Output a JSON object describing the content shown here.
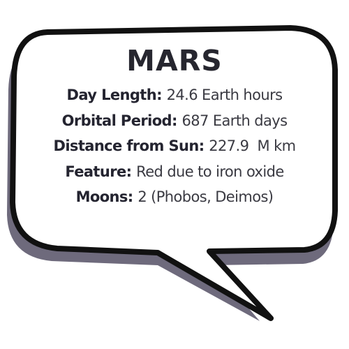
{
  "title": "MARS",
  "facts": [
    {
      "label": "Day Length",
      "value": "24.6 Earth hours"
    },
    {
      "label": "Orbital Period",
      "value": "687 Earth days"
    },
    {
      "label": "Distance from Sun",
      "value": "227.9  M km"
    },
    {
      "label": "Feature",
      "value": "Red due to iron oxide"
    },
    {
      "label": "Moons",
      "value": "2 (Phobos, Deimos)"
    }
  ],
  "colors": {
    "bubble_fill": "#ffffff",
    "bubble_outline": "#111111",
    "bubble_shadow": "#6e6a7c",
    "text": "#2b2b36"
  }
}
